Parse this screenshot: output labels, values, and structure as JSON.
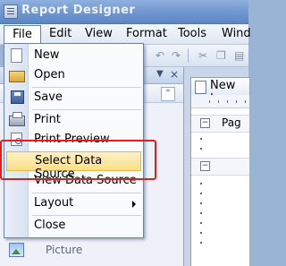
{
  "window": {
    "title": "Report Designer"
  },
  "menubar": {
    "items": [
      {
        "label": "File",
        "mnemonic": "F"
      },
      {
        "label": "Edit",
        "mnemonic": "E"
      },
      {
        "label": "View",
        "mnemonic": "V"
      },
      {
        "label": "Format",
        "mnemonic": "o"
      },
      {
        "label": "Tools",
        "mnemonic": "T"
      },
      {
        "label": "Wind",
        "mnemonic": "W"
      }
    ]
  },
  "file_menu": {
    "items": [
      {
        "label": "New",
        "icon": "new-document-icon"
      },
      {
        "label": "Open",
        "icon": "open-folder-icon"
      },
      {
        "label": "Save",
        "icon": "save-disk-icon"
      },
      {
        "label": "Print",
        "icon": "printer-icon"
      },
      {
        "label": "Print Preview",
        "icon": "print-preview-icon"
      },
      {
        "label": "Select Data Source",
        "highlighted": true
      },
      {
        "label": "View Data Source"
      },
      {
        "label": "Layout",
        "has_submenu": true
      },
      {
        "label": "Close"
      }
    ]
  },
  "toolbox": {
    "visible_item": "Picture"
  },
  "document": {
    "tab_label": "New Lay",
    "sections": [
      "Pag",
      ""
    ]
  },
  "colors": {
    "titlebar": "#6f96cf",
    "menu_highlight": "#fbdf86",
    "annotation_box": "#e11d1d"
  }
}
